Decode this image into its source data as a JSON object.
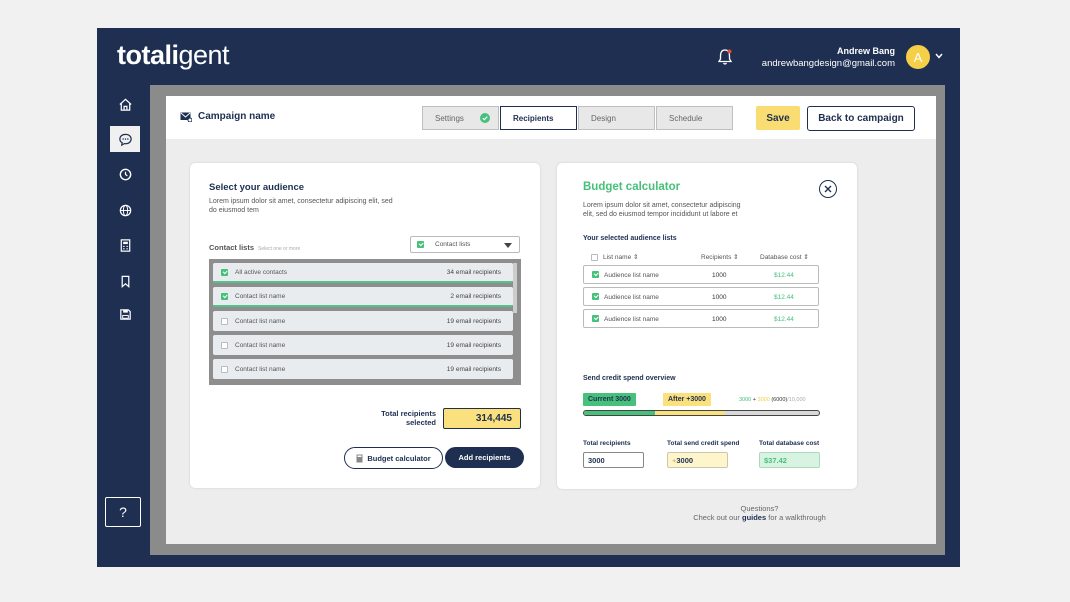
{
  "header": {
    "logo_bold": "totali",
    "logo_light": "gent",
    "user_name": "Andrew Bang",
    "user_email": "andrewbangdesign@gmail.com",
    "avatar_initial": "A"
  },
  "help_label": "?",
  "topbar": {
    "campaign_name": "Campaign name",
    "steps": [
      {
        "label": "Settings",
        "state": "done"
      },
      {
        "label": "Recipients",
        "state": "active"
      },
      {
        "label": "Design",
        "state": "todo"
      },
      {
        "label": "Schedule",
        "state": "todo"
      }
    ],
    "save_label": "Save",
    "back_label": "Back to campaign"
  },
  "audience": {
    "title": "Select your audience",
    "desc": "Lorem ipsum dolor sit amet, consectetur adipiscing elit, sed do eiusmod tem",
    "contact_lists_label": "Contact lists",
    "contact_lists_hint": "Select one or more",
    "dropdown_value": "Contact lists",
    "rows": [
      {
        "name": "All active contacts",
        "count": "34 email recipients",
        "checked": true
      },
      {
        "name": "Contact list name",
        "count": "2 email recipients",
        "checked": true
      },
      {
        "name": "Contact list name",
        "count": "19 email recipients",
        "checked": false
      },
      {
        "name": "Contact list name",
        "count": "19 email recipients",
        "checked": false
      },
      {
        "name": "Contact list name",
        "count": "19 email recipients",
        "checked": false
      }
    ],
    "total_label": "Total recipients selected",
    "total_value": "314,445",
    "budget_btn": "Budget calculator",
    "add_btn": "Add recipients"
  },
  "budget": {
    "title": "Budget calculator",
    "desc": "Lorem ipsum dolor sit amet, consectetur adipiscing elit, sed do eiusmod tempor incididunt ut labore et",
    "selected_title": "Your selected audience lists",
    "col_list": "List name",
    "col_recipients": "Recipients",
    "col_cost": "Database cost",
    "rows": [
      {
        "name": "Audience list name",
        "recipients": "1000",
        "cost": "$12.44"
      },
      {
        "name": "Audience list name",
        "recipients": "1000",
        "cost": "$12.44"
      },
      {
        "name": "Audience list name",
        "recipients": "1000",
        "cost": "$12.44"
      }
    ],
    "overview_title": "Send credit spend overview",
    "current_label": "Current 3000",
    "after_label": "After +3000",
    "calc_current": "3000",
    "calc_plus": "+",
    "calc_after": "3000",
    "calc_total": "(6000)",
    "calc_max": "/10,000",
    "current_fraction": 0.3,
    "after_fraction": 0.3,
    "total_recipients_label": "Total recipients",
    "total_recipients_value": "3000",
    "total_send_label": "Total send credit spend",
    "total_send_value": "3000",
    "total_send_prefix": "+",
    "total_db_label": "Total database cost",
    "total_db_value": "$37.42"
  },
  "footer": {
    "questions": "Questions?",
    "check_out": "Check out our",
    "guides": "guides",
    "walkthrough": "for a walkthrough"
  },
  "colors": {
    "navy": "#1e2f52",
    "green": "#46c07a",
    "yellow": "#fbe17d"
  }
}
